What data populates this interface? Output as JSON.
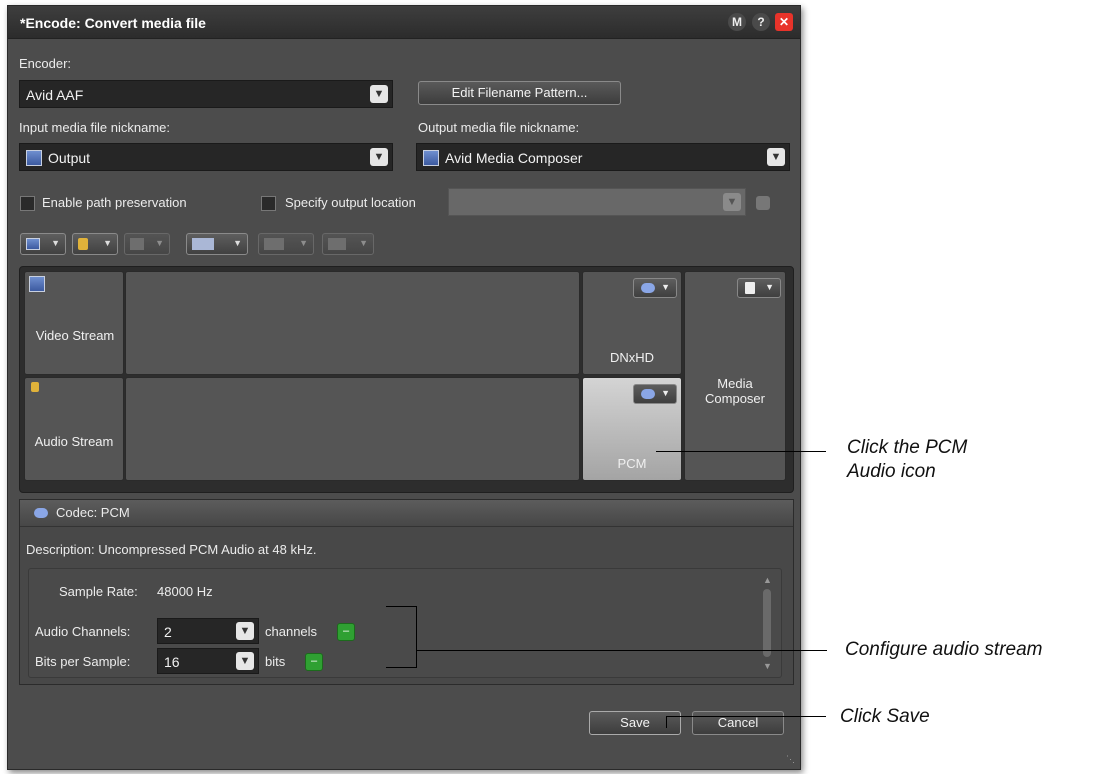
{
  "window": {
    "title": "*Encode: Convert media file",
    "buttons": {
      "m": "M",
      "help": "?",
      "close": "✕"
    }
  },
  "encoder": {
    "label": "Encoder:",
    "value": "Avid AAF",
    "edit_pattern_button": "Edit Filename Pattern..."
  },
  "input_nickname": {
    "label": "Input media file nickname:",
    "value": "Output"
  },
  "output_nickname": {
    "label": "Output media file nickname:",
    "value": "Avid Media Composer"
  },
  "options": {
    "path_preservation": "Enable path preservation",
    "specify_output": "Specify output location",
    "output_location_value": ""
  },
  "stream_grid": {
    "video_stream": "Video Stream",
    "audio_stream": "Audio Stream",
    "video_codec": "DNxHD",
    "audio_codec": "PCM",
    "container": "Media Composer"
  },
  "codec_panel": {
    "header": "Codec: PCM",
    "description": "Description:  Uncompressed PCM Audio at 48 kHz.",
    "sample_rate_label": "Sample Rate:",
    "sample_rate_value": "48000  Hz",
    "audio_channels_label": "Audio Channels:",
    "audio_channels_value": "2",
    "audio_channels_unit": "channels",
    "bits_label": "Bits per Sample:",
    "bits_value": "16",
    "bits_unit": "bits"
  },
  "footer": {
    "save": "Save",
    "cancel": "Cancel"
  },
  "annotations": {
    "pcm": "Click the PCM\nAudio icon",
    "pcm_line1": "Click the PCM",
    "pcm_line2": "Audio icon",
    "configure": "Configure audio stream",
    "save": "Click Save"
  },
  "colors": {
    "accent_close": "#e8332a",
    "green_button": "#2fa032",
    "window_bg": "#4c4c4c"
  }
}
